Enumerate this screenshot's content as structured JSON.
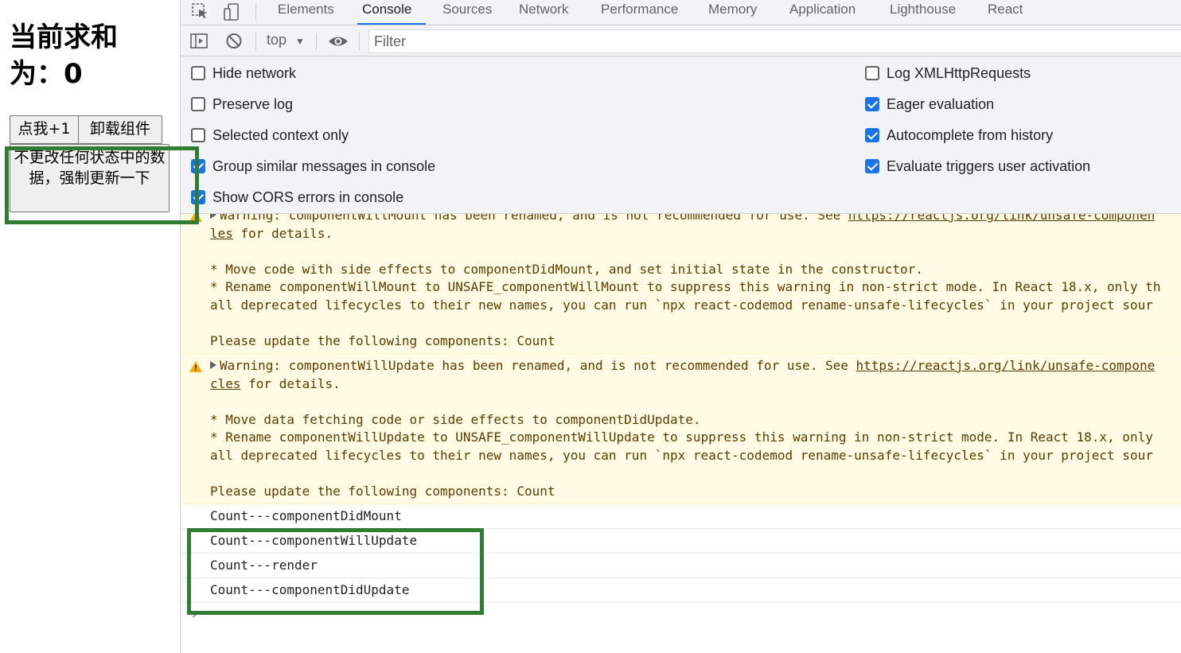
{
  "page": {
    "sum_title": "当前求和为：0",
    "add_button": "点我+1",
    "unmount_button": "卸载组件",
    "force_update_button": "不更改任何状态中的数据，强制更新一下"
  },
  "devtools": {
    "tabs": [
      "Elements",
      "Console",
      "Sources",
      "Network",
      "Performance",
      "Memory",
      "Application",
      "Lighthouse",
      "React"
    ],
    "active_tab": "Console",
    "toolbar": {
      "context": "top",
      "filter_placeholder": "Filter"
    },
    "settings": {
      "left": [
        {
          "label": "Hide network",
          "checked": false
        },
        {
          "label": "Preserve log",
          "checked": false
        },
        {
          "label": "Selected context only",
          "checked": false
        },
        {
          "label": "Group similar messages in console",
          "checked": true
        },
        {
          "label": "Show CORS errors in console",
          "checked": true
        }
      ],
      "right": [
        {
          "label": "Log XMLHttpRequests",
          "checked": false
        },
        {
          "label": "Eager evaluation",
          "checked": true
        },
        {
          "label": "Autocomplete from history",
          "checked": true
        },
        {
          "label": "Evaluate triggers user activation",
          "checked": true
        }
      ]
    },
    "warnings": [
      {
        "line1_prefix": "Warning: componentWillMount has been renamed, and is not recommended for use. See ",
        "link_part1": "https://reactjs.org/link/unsafe-componen",
        "link_part2": "les",
        "line2_suffix": " for details.",
        "bullet1": "* Move code with side effects to componentDidMount, and set initial state in the constructor.",
        "bullet2a": "* Rename componentWillMount to UNSAFE_componentWillMount to suppress this warning in non-strict mode. In React 18.x, only th",
        "bullet2b": "all deprecated lifecycles to their new names, you can run `npx react-codemod rename-unsafe-lifecycles` in your project sour",
        "footer": "Please update the following components: Count"
      },
      {
        "line1_prefix": "Warning: componentWillUpdate has been renamed, and is not recommended for use. See ",
        "link_part1": "https://reactjs.org/link/unsafe-compone",
        "link_part2": "cles",
        "line2_suffix": " for details.",
        "bullet1": "* Move data fetching code or side effects to componentDidUpdate.",
        "bullet2a": "* Rename componentWillUpdate to UNSAFE_componentWillUpdate to suppress this warning in non-strict mode. In React 18.x, only",
        "bullet2b": "all deprecated lifecycles to their new names, you can run `npx react-codemod rename-unsafe-lifecycles` in your project sour",
        "footer": "Please update the following components: Count"
      }
    ],
    "logs": [
      "Count---componentDidMount",
      "Count---componentWillUpdate",
      "Count---render",
      "Count---componentDidUpdate"
    ],
    "prompt": "›"
  },
  "colors": {
    "highlight": "#2e7d32",
    "warning_bg": "#fffbe5",
    "warning_text": "#5c3c00",
    "accent": "#1a73e8"
  }
}
